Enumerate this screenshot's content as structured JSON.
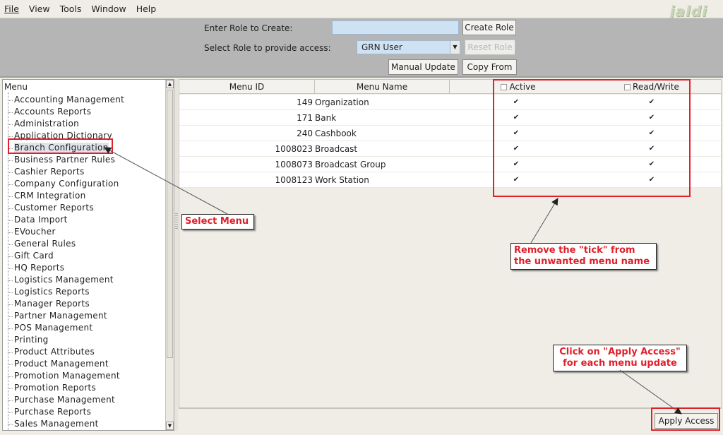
{
  "menubar": {
    "items": [
      "File",
      "View",
      "Tools",
      "Window",
      "Help"
    ],
    "logo": "jaldi"
  },
  "toolbar": {
    "create_role_label": "Enter Role to Create:",
    "create_role_value": "",
    "create_role_button": "Create Role",
    "select_role_label": "Select Role to provide access:",
    "select_role_value": "GRN User",
    "reset_role_button": "Reset Role",
    "manual_update_button": "Manual Update",
    "copy_from_button": "Copy  From"
  },
  "tree": {
    "root": "Menu",
    "selected": "Branch Configuration",
    "items": [
      "Accounting Management",
      "Accounts Reports",
      "Administration",
      "Application Dictionary",
      "Branch Configuration",
      "Business Partner Rules",
      "Cashier Reports",
      "Company Configuration",
      "CRM Integration",
      "Customer Reports",
      "Data Import",
      "EVoucher",
      "General Rules",
      "Gift Card",
      "HQ Reports",
      "Logistics Management",
      "Logistics Reports",
      "Manager Reports",
      "Partner Management",
      "POS Management",
      "Printing",
      "Product Attributes",
      "Product Management",
      "Promotion Management",
      "Promotion Reports",
      "Purchase Management",
      "Purchase Reports",
      "Sales Management"
    ]
  },
  "table": {
    "headers": {
      "menu_id": "Menu ID",
      "menu_name": "Menu Name",
      "active": "Active",
      "read_write": "Read/Write"
    },
    "rows": [
      {
        "id": "149",
        "name": "Organization",
        "active": true,
        "read_write": true
      },
      {
        "id": "171",
        "name": "Bank",
        "active": true,
        "read_write": true
      },
      {
        "id": "240",
        "name": "Cashbook",
        "active": true,
        "read_write": true
      },
      {
        "id": "1008023",
        "name": "Broadcast",
        "active": true,
        "read_write": true
      },
      {
        "id": "1008073",
        "name": "Broadcast Group",
        "active": true,
        "read_write": true
      },
      {
        "id": "1008123",
        "name": "Work Station",
        "active": true,
        "read_write": true
      }
    ],
    "check_glyph": "✔"
  },
  "footer": {
    "apply_access_button": "Apply Access"
  },
  "annotations": {
    "select_menu": "Select Menu",
    "remove_tick": "Remove the \"tick\" from the unwanted menu name",
    "apply_access_note": "Click on \"Apply Access\" for each menu update"
  },
  "colors": {
    "annotation_red": "#e0202a",
    "toolbar_gray": "#b5b5b5",
    "input_blue": "#cfe2f4"
  }
}
